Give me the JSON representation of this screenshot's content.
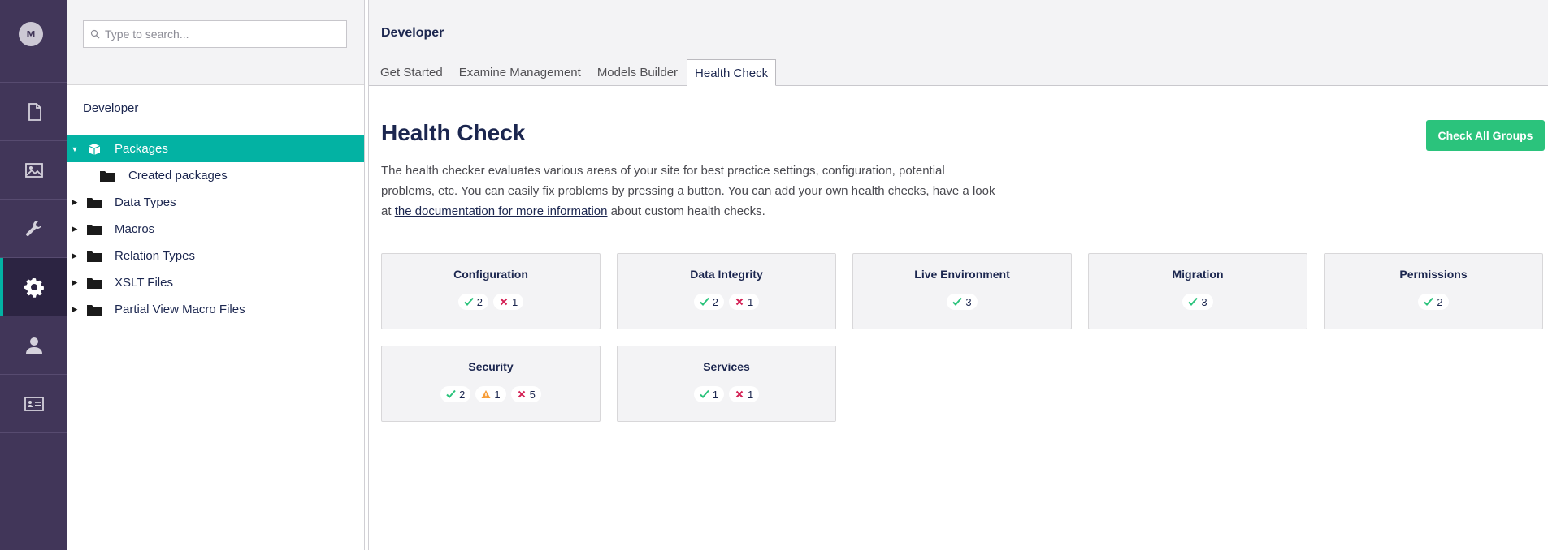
{
  "user": {
    "initial": "M"
  },
  "rail": [
    {
      "name": "content-section-icon",
      "icon": "document"
    },
    {
      "name": "media-section-icon",
      "icon": "image"
    },
    {
      "name": "settings-section-icon",
      "icon": "wrench"
    },
    {
      "name": "developer-section-icon",
      "icon": "gear",
      "active": true
    },
    {
      "name": "users-section-icon",
      "icon": "user"
    },
    {
      "name": "members-section-icon",
      "icon": "id-card"
    }
  ],
  "tree": {
    "search_placeholder": "Type to search...",
    "title": "Developer",
    "nodes": [
      {
        "label": "Packages",
        "icon": "package",
        "caret": "down",
        "active": true
      },
      {
        "label": "Created packages",
        "icon": "folder",
        "child": true
      },
      {
        "label": "Data Types",
        "icon": "folder",
        "caret": "right"
      },
      {
        "label": "Macros",
        "icon": "folder",
        "caret": "right"
      },
      {
        "label": "Relation Types",
        "icon": "folder",
        "caret": "right"
      },
      {
        "label": "XSLT Files",
        "icon": "folder",
        "caret": "right"
      },
      {
        "label": "Partial View Macro Files",
        "icon": "folder",
        "caret": "right"
      }
    ]
  },
  "header": {
    "section": "Developer",
    "tabs": [
      "Get Started",
      "Examine Management",
      "Models Builder",
      "Health Check"
    ],
    "active_tab": 3
  },
  "main": {
    "title": "Health Check",
    "check_all_label": "Check All Groups",
    "desc_before": "The health checker evaluates various areas of your site for best practice settings, configuration, potential problems, etc. You can easily fix problems by pressing a button. You can add your own health checks, have a look at ",
    "desc_link": "the documentation for more information",
    "desc_after": " about custom health checks.",
    "groups": [
      {
        "name": "Configuration",
        "success": 2,
        "error": 1
      },
      {
        "name": "Data Integrity",
        "success": 2,
        "error": 1
      },
      {
        "name": "Live Environment",
        "success": 3
      },
      {
        "name": "Migration",
        "success": 3
      },
      {
        "name": "Permissions",
        "success": 2
      },
      {
        "name": "Security",
        "success": 2,
        "warning": 1,
        "error": 5
      },
      {
        "name": "Services",
        "success": 1,
        "error": 1
      }
    ]
  },
  "colors": {
    "rail": "#413659",
    "accent": "#03b2a3",
    "button": "#2bc37c",
    "success": "#2bc37c",
    "error": "#d42054",
    "warning": "#f79c37"
  }
}
